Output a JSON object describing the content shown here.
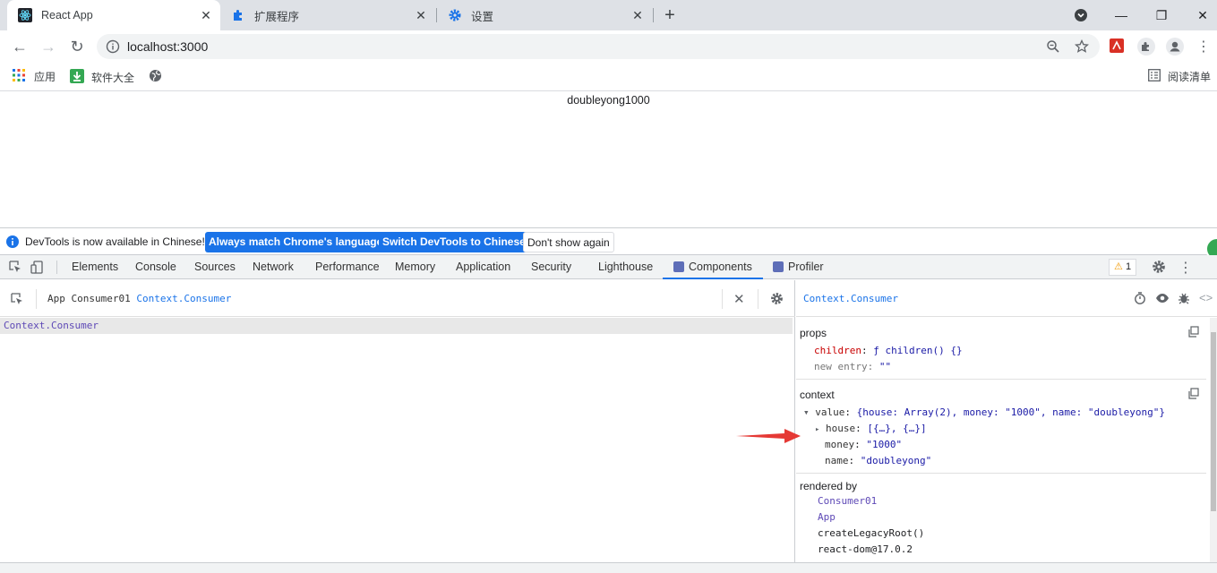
{
  "tabs": [
    {
      "title": "React App",
      "icon": "react-icon"
    },
    {
      "title": "扩展程序",
      "icon": "puzzle-icon"
    },
    {
      "title": "设置",
      "icon": "gear-icon"
    }
  ],
  "omnibox": {
    "url": "localhost:3000"
  },
  "bookmarks": [
    {
      "label": "应用",
      "icon": "apps-grid-icon"
    },
    {
      "label": "软件大全",
      "icon": "download-icon"
    },
    {
      "label": "",
      "icon": "globe-icon"
    }
  ],
  "reading_list": "阅读清单",
  "page": {
    "text": "doubleyong1000"
  },
  "infobar": {
    "message": "DevTools is now available in Chinese!",
    "btn_match": "Always match Chrome's language",
    "btn_switch": "Switch DevTools to Chinese",
    "btn_dismiss": "Don't show again"
  },
  "devtools": {
    "tabs": [
      "Elements",
      "Console",
      "Sources",
      "Network",
      "Performance",
      "Memory",
      "Application",
      "Security",
      "Lighthouse",
      "Components",
      "Profiler"
    ],
    "warning_count": "1"
  },
  "components": {
    "breadcrumb": [
      "App",
      "Consumer01",
      "Context.Consumer"
    ],
    "selected_row": "Context.Consumer",
    "side_title": "Context.Consumer",
    "props_label": "props",
    "props": [
      {
        "key": "children",
        "value": "ƒ children() {}"
      },
      {
        "key": "new entry",
        "value": "\"\""
      }
    ],
    "context_label": "context",
    "context_value_key": "value",
    "context_value": "{house: Array(2), money: \"1000\", name: \"doubleyong\"}",
    "context_children": [
      {
        "key": "house",
        "value": "[{…}, {…}]"
      },
      {
        "key": "money",
        "value": "\"1000\""
      },
      {
        "key": "name",
        "value": "\"doubleyong\""
      }
    ],
    "rendered_by_label": "rendered by",
    "rendered_by": [
      "Consumer01",
      "App",
      "createLegacyRoot()",
      "react-dom@17.0.2"
    ]
  }
}
